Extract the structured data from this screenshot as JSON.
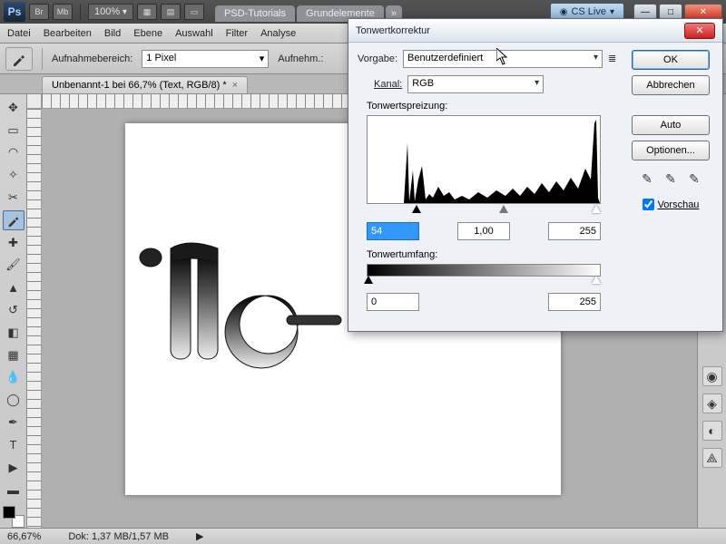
{
  "app": {
    "logo": "Ps",
    "top_icons": [
      "Br",
      "Mb"
    ],
    "zoom": "100%",
    "tabs": [
      "PSD-Tutorials",
      "Grundelemente"
    ],
    "more": "»",
    "cs_live": "CS Live",
    "menu": [
      "Datei",
      "Bearbeiten",
      "Bild",
      "Ebene",
      "Auswahl",
      "Filter",
      "Analyse"
    ]
  },
  "opts": {
    "sample_label": "Aufnahmebereich:",
    "sample_value": "1 Pixel",
    "aufnehm_label": "Aufnehm.:"
  },
  "doc": {
    "title": "Unbenannt-1 bei 66,7% (Text, RGB/8) *"
  },
  "status": {
    "zoom": "66,67%",
    "doc_info": "Dok: 1,37 MB/1,57 MB"
  },
  "dialog": {
    "title": "Tonwertkorrektur",
    "preset_label": "Vorgabe:",
    "preset_value": "Benutzerdefiniert",
    "channel_label": "Kanal:",
    "channel_value": "RGB",
    "spread_label": "Tonwertspreizung:",
    "input_black": "54",
    "input_gamma": "1,00",
    "input_white": "255",
    "range_label": "Tonwertumfang:",
    "output_black": "0",
    "output_white": "255",
    "ok": "OK",
    "cancel": "Abbrechen",
    "auto": "Auto",
    "options": "Optionen...",
    "preview": "Vorschau"
  }
}
